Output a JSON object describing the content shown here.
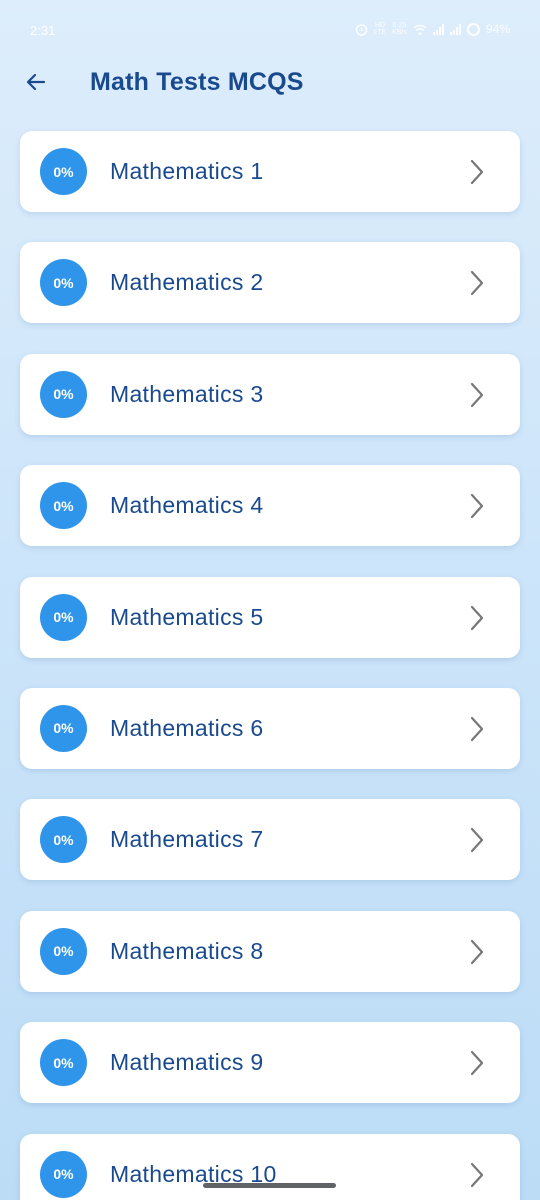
{
  "status_bar": {
    "time": "2:31",
    "network_speed": "0.25\nKB/s",
    "battery": "94%"
  },
  "header": {
    "title": "Math Tests MCQS",
    "back_icon": "arrow-left-icon"
  },
  "tests": [
    {
      "label": "Mathematics 1",
      "progress": "0%"
    },
    {
      "label": "Mathematics 2",
      "progress": "0%"
    },
    {
      "label": "Mathematics 3",
      "progress": "0%"
    },
    {
      "label": "Mathematics 4",
      "progress": "0%"
    },
    {
      "label": "Mathematics 5",
      "progress": "0%"
    },
    {
      "label": "Mathematics 6",
      "progress": "0%"
    },
    {
      "label": "Mathematics 7",
      "progress": "0%"
    },
    {
      "label": "Mathematics 8",
      "progress": "0%"
    },
    {
      "label": "Mathematics 9",
      "progress": "0%"
    },
    {
      "label": "Mathematics 10",
      "progress": "0%"
    }
  ],
  "colors": {
    "accent": "#2f95ea",
    "title_text": "#1a4a8e",
    "chevron": "#777777"
  }
}
